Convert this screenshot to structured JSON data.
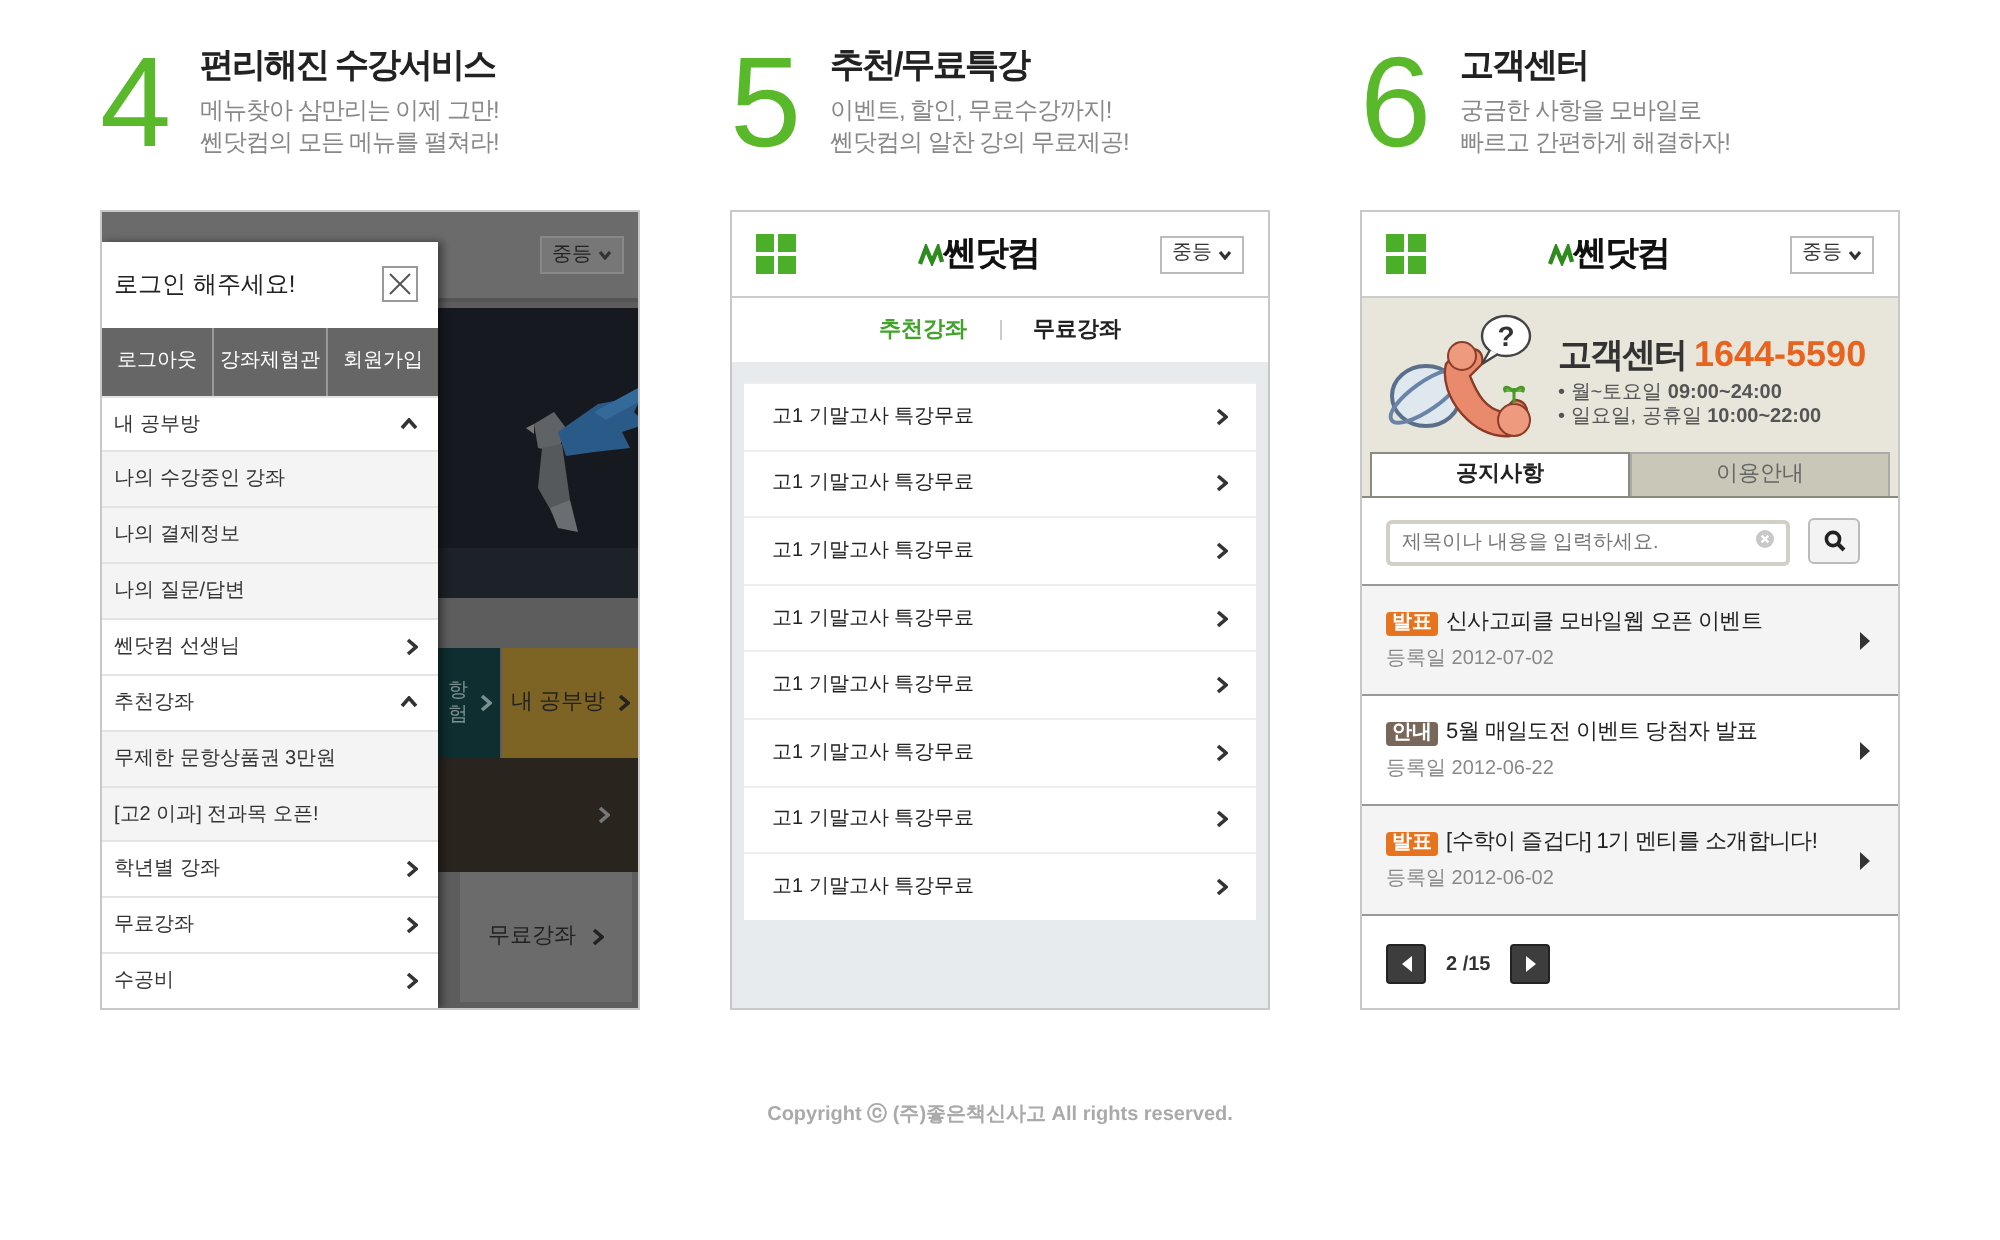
{
  "features": [
    {
      "kind": "menu",
      "number": "4",
      "title": "편리해진 수강서비스",
      "description": [
        "메뉴찾아 삼만리는 이제 그만!",
        "쎈닷컴의 모든 메뉴를 펼쳐라!"
      ],
      "background_screen": {
        "grade_select": "중등",
        "cut_tile_lines": [
          "항",
          "험"
        ],
        "tile": "내 공부방",
        "bottom_tile": "무료강좌"
      },
      "drawer": {
        "login_prompt": "로그인 해주세요!",
        "buttons": [
          "로그아웃",
          "강좌체험관",
          "회원가입"
        ],
        "items": [
          {
            "label": "내 공부방",
            "expanded": true,
            "children": [
              {
                "label": "나의 수강중인 강좌"
              },
              {
                "label": "나의 결제정보"
              },
              {
                "label": "나의 질문/답변"
              }
            ]
          },
          {
            "label": "쎈닷컴 선생님",
            "expanded": false
          },
          {
            "label": "추천강좌",
            "expanded": true,
            "children": [
              {
                "label": "무제한 문항상품권 3만원"
              },
              {
                "label": "[고2 이과] 전과목 오픈!"
              }
            ]
          },
          {
            "label": "학년별 강좌",
            "expanded": false
          },
          {
            "label": "무료강좌",
            "expanded": false
          },
          {
            "label": "수공비",
            "expanded": false
          }
        ]
      }
    },
    {
      "kind": "lectures",
      "number": "5",
      "title": "추천/무료특강",
      "description": [
        "이벤트, 할인, 무료수강까지!",
        "쎈닷컴의 알찬 강의 무료제공!"
      ],
      "header": {
        "logo": "쎈닷컴",
        "grade_select": "중등"
      },
      "tabs": [
        {
          "label": "추천강좌",
          "selected": true
        },
        {
          "label": "무료강좌",
          "selected": false
        }
      ],
      "lectures": [
        "고1 기말고사 특강무료",
        "고1 기말고사 특강무료",
        "고1 기말고사 특강무료",
        "고1 기말고사 특강무료",
        "고1 기말고사 특강무료",
        "고1 기말고사 특강무료",
        "고1 기말고사 특강무료",
        "고1 기말고사 특강무료"
      ]
    },
    {
      "kind": "support",
      "number": "6",
      "title": "고객센터",
      "description": [
        "궁금한 사항을 모바일로",
        "빠르고 간편하게 해결하자!"
      ],
      "header": {
        "logo": "쎈닷컴",
        "grade_select": "중등"
      },
      "banner": {
        "bubble_mark": "?",
        "title": "고객센터",
        "phone": "1644-5590",
        "hours": [
          "• 월~토요일 **09:00~24:00**",
          "• 일요일, 공휴일 **10:00~22:00**"
        ]
      },
      "tabs": [
        {
          "label": "공지사항",
          "selected": true
        },
        {
          "label": "이용안내",
          "selected": false
        }
      ],
      "search": {
        "placeholder": "제목이나 내용을 입력하세요."
      },
      "notices": [
        {
          "badge": "발표",
          "color": "#e8731e",
          "title": "신사고피클 모바일웹 오픈 이벤트",
          "date": "등록일 2012-07-02"
        },
        {
          "badge": "안내",
          "color": "#7a675b",
          "title": "5월 매일도전 이벤트 당첨자 발표",
          "date": "등록일 2012-06-22"
        },
        {
          "badge": "발표",
          "color": "#e8731e",
          "title": "[수학이 즐겁다] 1기 멘티를 소개합니다!",
          "date": "등록일 2012-06-02"
        }
      ],
      "pagination": {
        "page": "2 /15"
      }
    }
  ],
  "footer": {
    "copyright": "Copyright ⓒ (주)좋은책신사고  All rights reserved."
  }
}
